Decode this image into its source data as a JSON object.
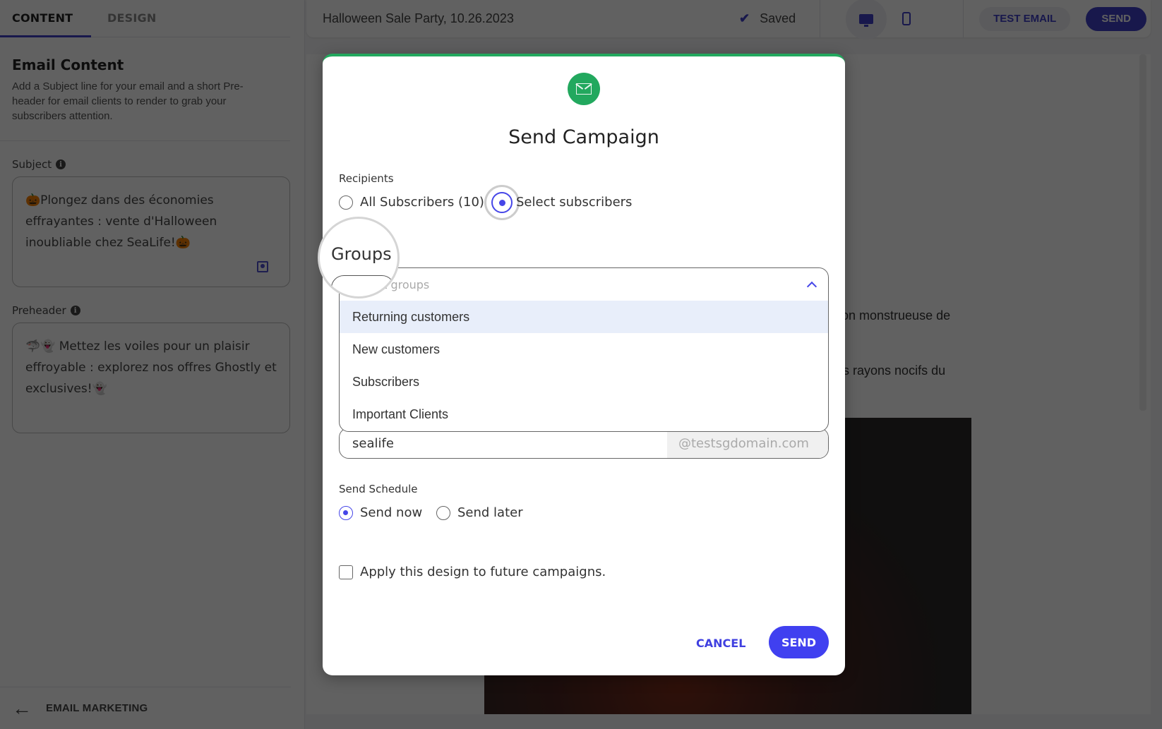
{
  "sidebar": {
    "tabs": [
      {
        "label": "CONTENT",
        "active": true
      },
      {
        "label": "DESIGN",
        "active": false
      }
    ],
    "section_title": "Email Content",
    "section_description": "Add a Subject line for your email and a short Pre-header for email clients to render to grab your subscribers attention.",
    "subject": {
      "label": "Subject",
      "value": "🎃Plongez dans des économies effrayantes : vente d'Halloween inoubliable chez SeaLife!🎃"
    },
    "preheader": {
      "label": "Preheader",
      "value": "🦈👻 Mettez les voiles pour un plaisir effroyable : explorez nos offres Ghostly et exclusives!👻"
    },
    "back_link": "EMAIL MARKETING"
  },
  "topbar": {
    "campaign_name": "Halloween Sale Party, 10.26.2023",
    "save_status": "Saved",
    "test_email_label": "TEST EMAIL",
    "send_label": "SEND"
  },
  "preview": {
    "text_line_1": "ction monstrueuse de",
    "text_line_2": "des rayons nocifs du"
  },
  "modal": {
    "title": "Send Campaign",
    "recipients_label": "Recipients",
    "recipient_options": [
      {
        "label": "All Subscribers (10)",
        "checked": false
      },
      {
        "label": "Select subscribers",
        "checked": true
      }
    ],
    "groups_label": "Groups",
    "groups_placeholder": "Select groups",
    "group_options": [
      {
        "label": "Returning customers",
        "highlighted": true
      },
      {
        "label": "New customers",
        "highlighted": false
      },
      {
        "label": "Subscribers",
        "highlighted": false
      },
      {
        "label": "Important Clients",
        "highlighted": false
      }
    ],
    "sender_local": "sealife",
    "sender_domain": "@testsgdomain.com",
    "schedule_label": "Send Schedule",
    "schedule_options": [
      {
        "label": "Send now",
        "checked": true
      },
      {
        "label": "Send later",
        "checked": false
      }
    ],
    "apply_design_label": "Apply this design to future campaigns.",
    "cancel_label": "CANCEL",
    "send_label": "SEND"
  },
  "colors": {
    "accent": "#4040f0",
    "success": "#22a85e",
    "highlight_row": "#e8eefa"
  }
}
